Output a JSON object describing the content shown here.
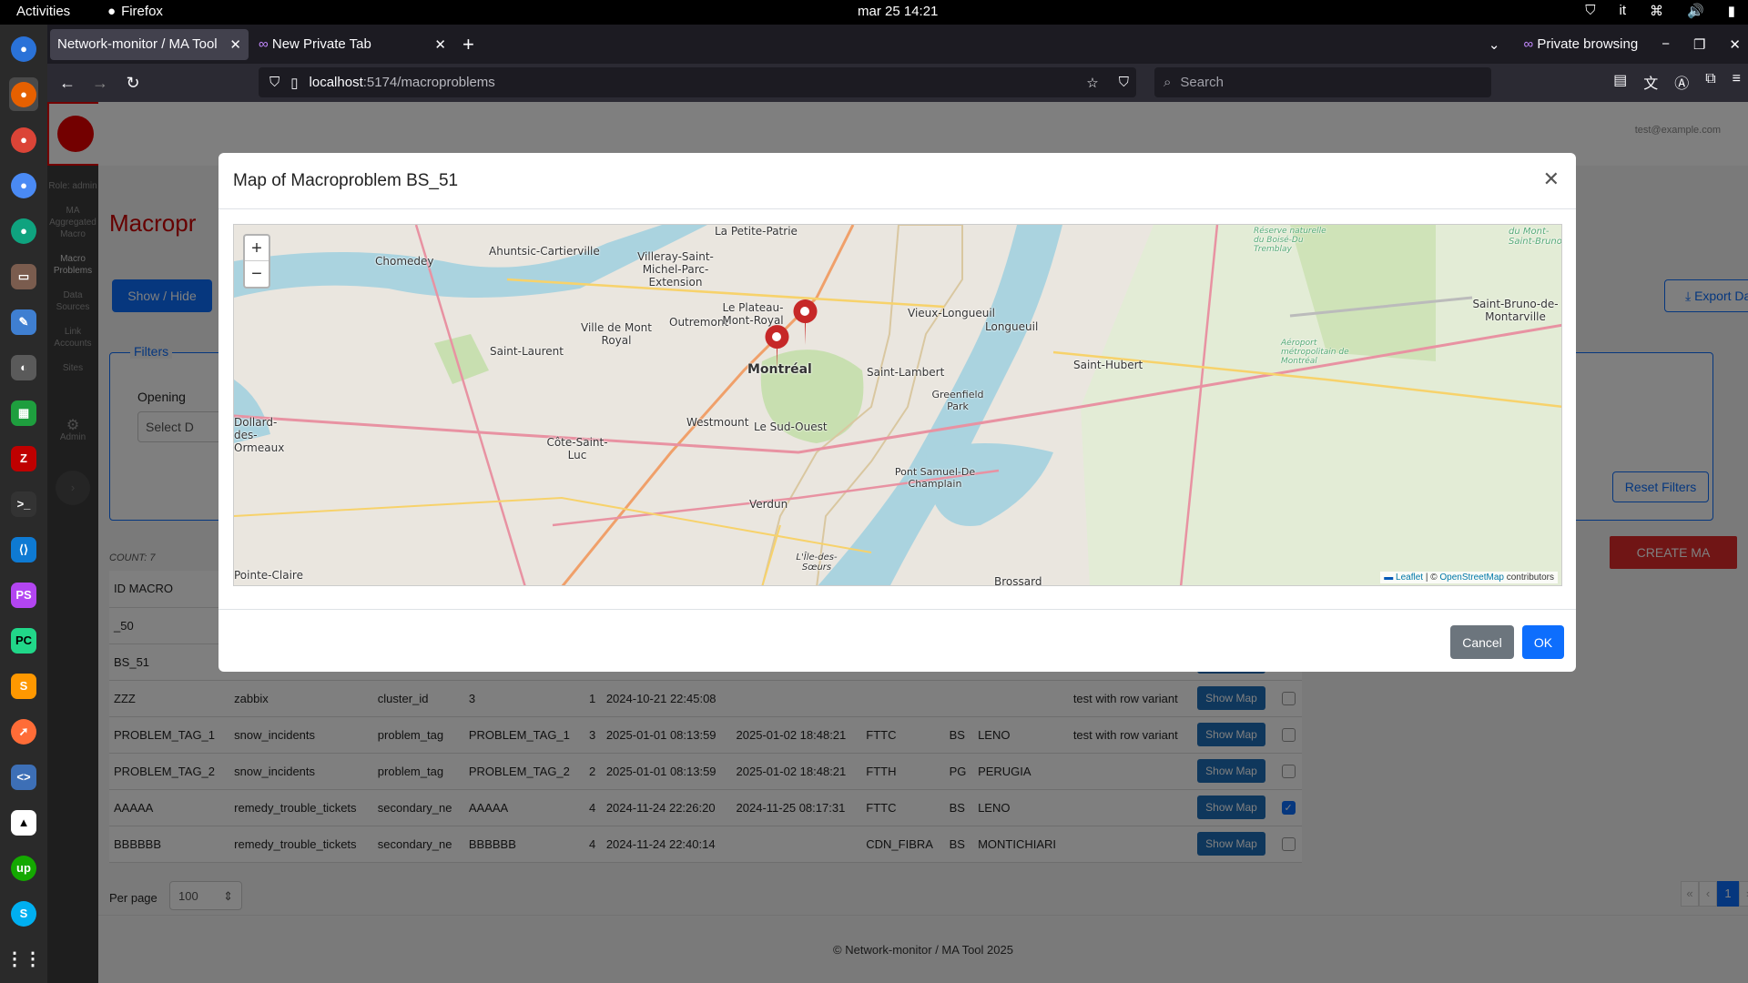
{
  "system": {
    "activities": "Activities",
    "app_name": "Firefox",
    "clock": "mar 25  14:21",
    "lang": "it"
  },
  "browser": {
    "tabs": [
      {
        "label": "Network-monitor / MA Tool"
      },
      {
        "label": "New Private Tab"
      }
    ],
    "private_label": "Private browsing",
    "url_host": "localhost",
    "url_path": ":5174/macroproblems",
    "search_placeholder": "Search"
  },
  "app": {
    "user_email": "test@example.com",
    "sidebar": {
      "role": "Role: admin",
      "items": [
        "MA Aggregated Macro",
        "Macro Problems",
        "Data Sources",
        "Link Accounts",
        "Sites",
        "Admin"
      ]
    },
    "page_title": "Macropr",
    "show_hide_label": "Show / Hide",
    "export_label": "Export Data",
    "filters_legend": "Filters",
    "opening_label": "Opening",
    "select_placeholder": "Select D",
    "reset_label": "Reset Filters",
    "create_label": "CREATE MA",
    "count_label": "COUNT: 7",
    "table_header": "ID MACRO",
    "rows": [
      {
        "id": "_50",
        "source": "",
        "tag": "",
        "value": "",
        "count": "",
        "open": "",
        "close": "",
        "type": "",
        "reg": "",
        "city": "",
        "note": "",
        "checked": false,
        "map": false
      },
      {
        "id": "BS_51",
        "source": "",
        "tag": "",
        "value": "",
        "count": "",
        "open": "",
        "close": "",
        "type": "",
        "reg": "",
        "city": "",
        "note": "",
        "checked": false,
        "map": true
      },
      {
        "id": "ZZZ",
        "source": "zabbix",
        "tag": "cluster_id",
        "value": "3",
        "count": "1",
        "open": "2024-10-21 22:45:08",
        "close": "",
        "type": "",
        "reg": "",
        "city": "",
        "note": "test with row variant",
        "checked": false,
        "map": true
      },
      {
        "id": "PROBLEM_TAG_1",
        "source": "snow_incidents",
        "tag": "problem_tag",
        "value": "PROBLEM_TAG_1",
        "count": "3",
        "open": "2025-01-01 08:13:59",
        "close": "2025-01-02 18:48:21",
        "type": "FTTC",
        "reg": "BS",
        "city": "LENO",
        "note": "test with row variant",
        "checked": false,
        "map": true
      },
      {
        "id": "PROBLEM_TAG_2",
        "source": "snow_incidents",
        "tag": "problem_tag",
        "value": "PROBLEM_TAG_2",
        "count": "2",
        "open": "2025-01-01 08:13:59",
        "close": "2025-01-02 18:48:21",
        "type": "FTTH",
        "reg": "PG",
        "city": "PERUGIA",
        "note": "",
        "checked": false,
        "map": true
      },
      {
        "id": "AAAAA",
        "source": "remedy_trouble_tickets",
        "tag": "secondary_ne",
        "value": "AAAAA",
        "count": "4",
        "open": "2024-11-24 22:26:20",
        "close": "2024-11-25 08:17:31",
        "type": "FTTC",
        "reg": "BS",
        "city": "LENO",
        "note": "",
        "checked": true,
        "map": true
      },
      {
        "id": "BBBBBB",
        "source": "remedy_trouble_tickets",
        "tag": "secondary_ne",
        "value": "BBBBBB",
        "count": "4",
        "open": "2024-11-24 22:40:14",
        "close": "",
        "type": "CDN_FIBRA",
        "reg": "BS",
        "city": "MONTICHIARI",
        "note": "",
        "checked": false,
        "map": true
      }
    ],
    "show_map_label": "Show Map",
    "per_page_label": "Per page",
    "per_page_value": "100",
    "page_number": "1",
    "footer": "© Network-monitor / MA Tool 2025"
  },
  "modal": {
    "title": "Map of Macroproblem BS_51",
    "cancel_label": "Cancel",
    "ok_label": "OK",
    "zoom_in": "+",
    "zoom_out": "−",
    "attribution_leaflet": "Leaflet",
    "attribution_osm": "OpenStreetMap",
    "attribution_rest": "contributors",
    "map_labels": [
      "La Petite-Patrie",
      "Ahuntsic-Cartierville",
      "Villeray-Saint-Michel-Parc-Extension",
      "Chomedey",
      "Ville de Mont Royal",
      "Outremont",
      "Le Plateau-Mont-Royal",
      "Saint-Laurent",
      "Montréal",
      "Westmount",
      "Le Sud-Ouest",
      "Côte-Saint-Luc",
      "Dollard-des-Ormeaux",
      "Verdun",
      "Saint-Lambert",
      "Greenfield Park",
      "Pont Samuel-De Champlain",
      "Vieux-Longueuil",
      "Longueuil",
      "Saint-Hubert",
      "Saint-Bruno-de-Montarville",
      "Brossard",
      "L'Île-des-Sœurs",
      "Pointe-Claire",
      "Aéroport métropolitain de Montréal",
      "Réserve naturelle du Boisé-Du Tremblay",
      "du Mont-Saint-Bruno"
    ]
  }
}
